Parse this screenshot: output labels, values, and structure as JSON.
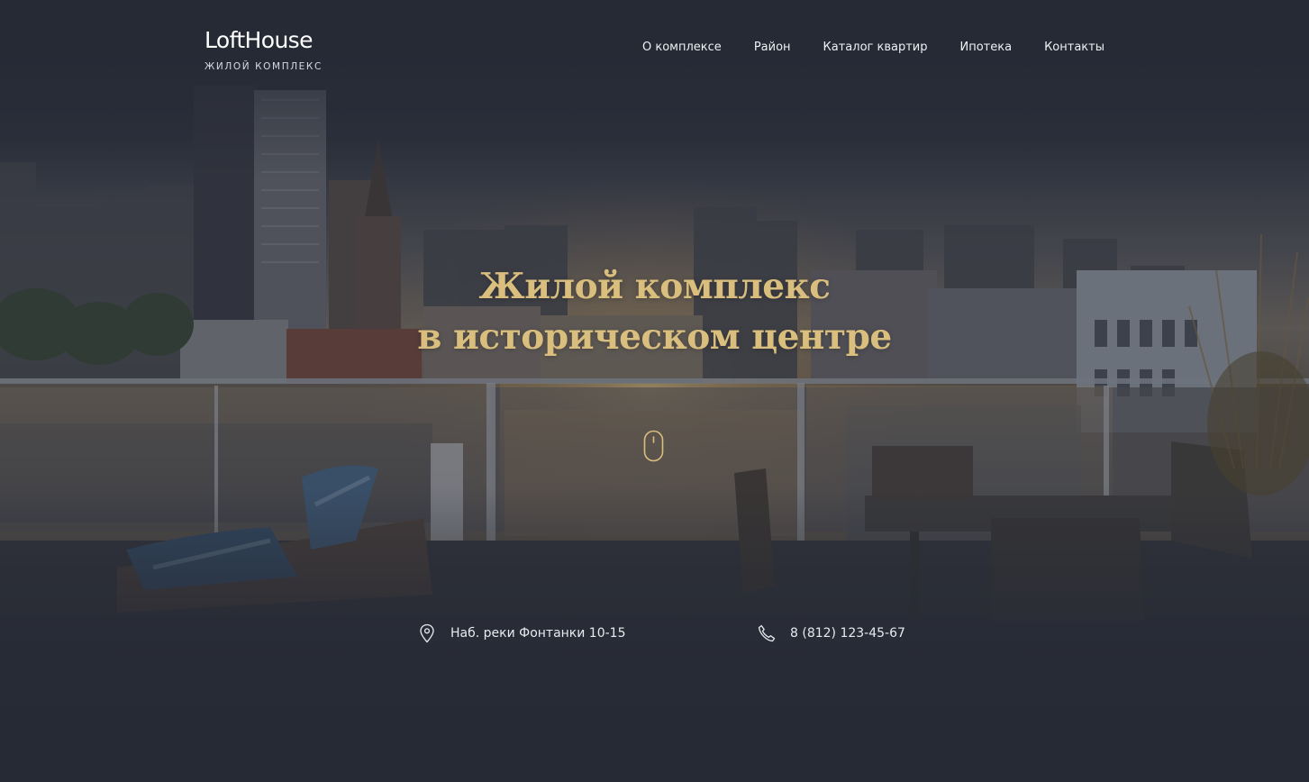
{
  "colors": {
    "accent_gold": "#d9be7d",
    "background": "#262a35",
    "header_text": "#eef0f4"
  },
  "header": {
    "logo_title": "LoftHouse",
    "logo_subtitle": "ЖИЛОЙ КОМПЛЕКС",
    "nav": [
      {
        "label": "О комплексе"
      },
      {
        "label": "Район"
      },
      {
        "label": "Каталог квартир"
      },
      {
        "label": "Ипотека"
      },
      {
        "label": "Контакты"
      }
    ]
  },
  "hero": {
    "title_line1": "Жилой комплекс",
    "title_line2": "в историческом центре",
    "scroll_icon": "mouse-scroll-icon",
    "background": "city-rooftop-terrace-photo"
  },
  "contacts": {
    "address_icon": "location-pin-icon",
    "address": "Наб. реки Фонтанки 10-15",
    "phone_icon": "phone-icon",
    "phone": "8 (812) 123-45-67"
  }
}
